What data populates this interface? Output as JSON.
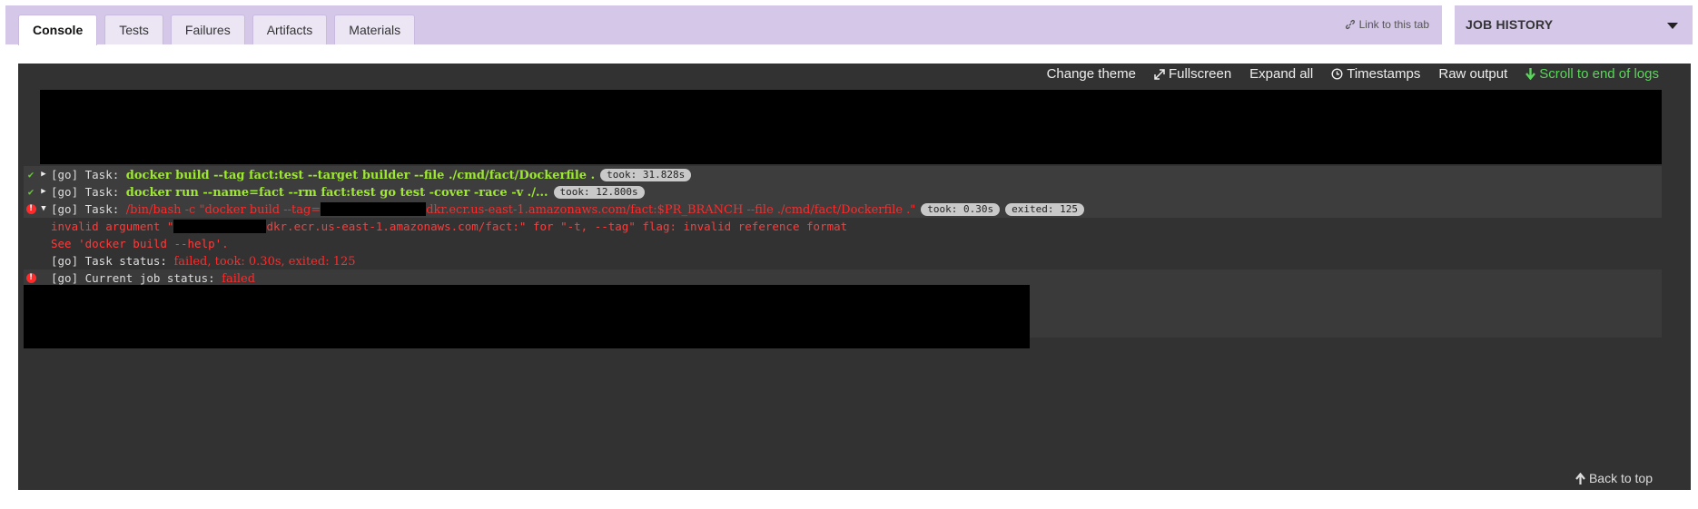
{
  "tabs": [
    {
      "label": "Console",
      "active": true
    },
    {
      "label": "Tests",
      "active": false
    },
    {
      "label": "Failures",
      "active": false
    },
    {
      "label": "Artifacts",
      "active": false
    },
    {
      "label": "Materials",
      "active": false
    }
  ],
  "link_tab": "Link to this tab",
  "job_history": {
    "label": "JOB HISTORY"
  },
  "toolbar": {
    "change_theme": "Change theme",
    "fullscreen": "Fullscreen",
    "expand_all": "Expand all",
    "timestamps": "Timestamps",
    "raw_output": "Raw output",
    "scroll_end": "Scroll to end of logs"
  },
  "log": {
    "task1": {
      "prefix": "[go] Task: ",
      "command": "docker build --tag fact:test --target builder --file ./cmd/fact/Dockerfile .",
      "took": "took: 31.828s"
    },
    "task2": {
      "prefix": "[go] Task: ",
      "command": "docker run --name=fact --rm fact:test go test -cover -race -v ./...",
      "took": "took: 12.800s"
    },
    "task3": {
      "prefix": "[go] Task: ",
      "command_a": "/bin/bash -c \"docker build --tag=",
      "command_b": "dkr.ecr.us-east-1.amazonaws.com/fact:$PR_BRANCH --file ./cmd/fact/Dockerfile .\"",
      "took": "took: 0.30s",
      "exited": "exited: 125"
    },
    "err1_a": "invalid argument \"",
    "err1_b": "dkr.ecr.us-east-1.amazonaws.com/fact:\" for \"-t, --tag\" flag: invalid reference format",
    "err2": "See 'docker build --help'.",
    "status_prefix": "[go] Task status: ",
    "status_value": "failed, took: 0.30s, exited: 125",
    "job_prefix": "[go] Current job status: ",
    "job_value": "failed"
  },
  "back_to_top": "Back to top",
  "colors": {
    "accent": "#d4c7e8",
    "console_bg": "#323232",
    "success": "#6ac83a",
    "error": "#ff2a2a",
    "scroll_green": "#5ad65a"
  }
}
